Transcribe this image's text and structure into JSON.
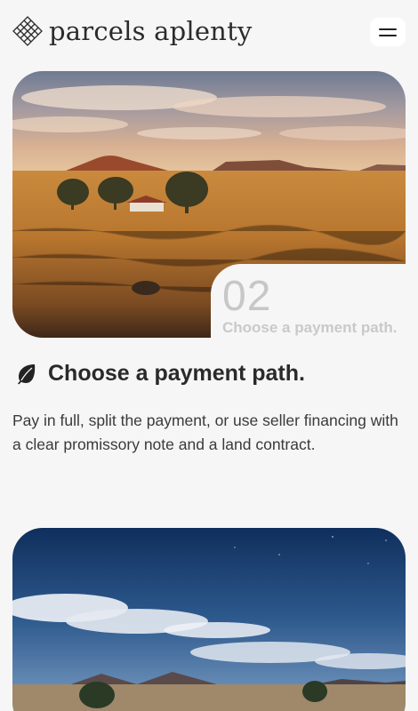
{
  "header": {
    "brand": "parcels aplenty",
    "logo_icon": "diamond-lattice-icon",
    "menu_icon": "hamburger-icon"
  },
  "step": {
    "number": "02",
    "caption": "Choose a payment path.",
    "image": "desert-ranch-photo"
  },
  "section": {
    "icon": "leaf-icon",
    "title": "Choose a payment path.",
    "description": "Pay in full, split the payment, or use seller financing with a clear promissory note and a land contract."
  },
  "next_card": {
    "image": "night-desert-photo"
  },
  "colors": {
    "background": "#f6f6f6",
    "text": "#2a2a2a",
    "muted": "#c8c8c8"
  }
}
